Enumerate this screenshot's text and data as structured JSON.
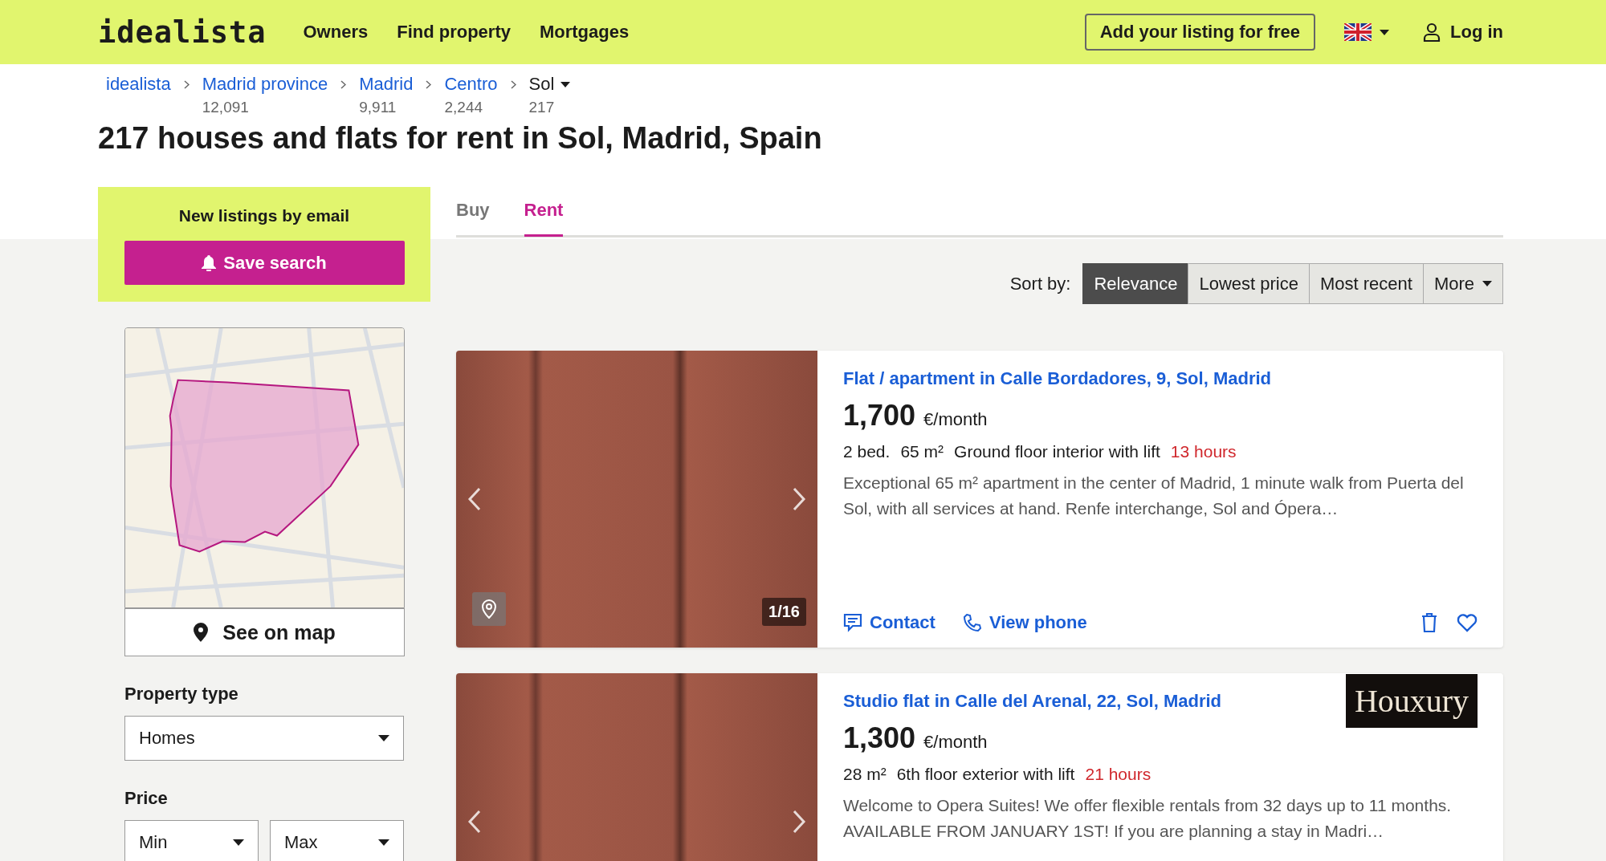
{
  "header": {
    "logo": "idealista",
    "nav": [
      "Owners",
      "Find property",
      "Mortgages"
    ],
    "add_listing": "Add your listing for free",
    "login": "Log in"
  },
  "breadcrumbs": [
    {
      "label": "idealista",
      "selected": false
    },
    {
      "label": "Madrid province",
      "count": "12,091",
      "selected": false
    },
    {
      "label": "Madrid",
      "count": "9,911",
      "selected": false
    },
    {
      "label": "Centro",
      "count": "2,244",
      "selected": false
    },
    {
      "label": "Sol",
      "count": "217",
      "selected": true
    }
  ],
  "title": "217 houses and flats for rent in Sol, Madrid, Spain",
  "alert": {
    "title": "New listings by email",
    "button": "Save search"
  },
  "map": {
    "button": "See on map"
  },
  "filters": [
    {
      "label": "Property type",
      "selects": [
        "Homes"
      ]
    },
    {
      "label": "Price",
      "selects": [
        "Min",
        "Max"
      ]
    }
  ],
  "tabs": [
    {
      "label": "Buy",
      "selected": false
    },
    {
      "label": "Rent",
      "selected": true
    }
  ],
  "sort": {
    "label": "Sort by:",
    "options": [
      {
        "label": "Relevance",
        "kind": "option",
        "selected": true
      },
      {
        "label": "Lowest price",
        "kind": "option",
        "selected": false
      },
      {
        "label": "Most recent",
        "kind": "option",
        "selected": false
      },
      {
        "label": "More",
        "kind": "dropdown",
        "selected": false
      }
    ]
  },
  "listings": [
    {
      "title": "Flat / apartment in Calle Bordadores, 9, Sol, Madrid",
      "price": "1,700",
      "unit": "€/month",
      "details": [
        "2 bed.",
        "65 m²",
        "Ground floor interior with lift"
      ],
      "age": "13 hours",
      "description": "Exceptional 65 m² apartment in the center of Madrid, 1 minute walk from Puerta del Sol, with all services at hand. Renfe interchange, Sol and Ópera…",
      "photo_counter": "1/16",
      "actions": [
        "Contact",
        "View phone"
      ]
    },
    {
      "title": "Studio flat in Calle del Arenal, 22, Sol, Madrid",
      "price": "1,300",
      "unit": "€/month",
      "details": [
        "28 m²",
        "6th floor exterior with lift"
      ],
      "age": "21 hours",
      "description": "Welcome to Opera Suites! We offer flexible rentals from 32 days up to 11 months. AVAILABLE FROM JANUARY 1ST! If you are planning a stay in Madri…",
      "agency": "Houxury"
    }
  ]
}
